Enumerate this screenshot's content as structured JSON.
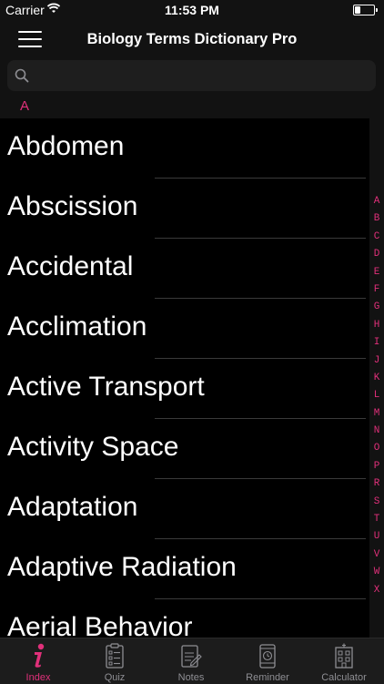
{
  "status": {
    "carrier": "Carrier",
    "time": "11:53 PM"
  },
  "nav": {
    "title": "Biology Terms Dictionary Pro"
  },
  "search": {
    "placeholder": ""
  },
  "section": {
    "header": "A"
  },
  "terms": [
    "Abdomen",
    "Abscission",
    "Accidental",
    "Acclimation",
    "Active Transport",
    "Activity Space",
    "Adaptation",
    "Adaptive Radiation",
    "Aerial Behavior"
  ],
  "index_letters": [
    "A",
    "B",
    "C",
    "D",
    "E",
    "F",
    "G",
    "H",
    "I",
    "J",
    "K",
    "L",
    "M",
    "N",
    "O",
    "P",
    "R",
    "S",
    "T",
    "U",
    "V",
    "W",
    "X"
  ],
  "tabs": [
    {
      "label": "Index",
      "icon": "info-icon"
    },
    {
      "label": "Quiz",
      "icon": "quiz-icon"
    },
    {
      "label": "Notes",
      "icon": "notes-icon"
    },
    {
      "label": "Reminder",
      "icon": "reminder-icon"
    },
    {
      "label": "Calculator",
      "icon": "calculator-icon"
    }
  ],
  "colors": {
    "accent": "#e0307a"
  }
}
